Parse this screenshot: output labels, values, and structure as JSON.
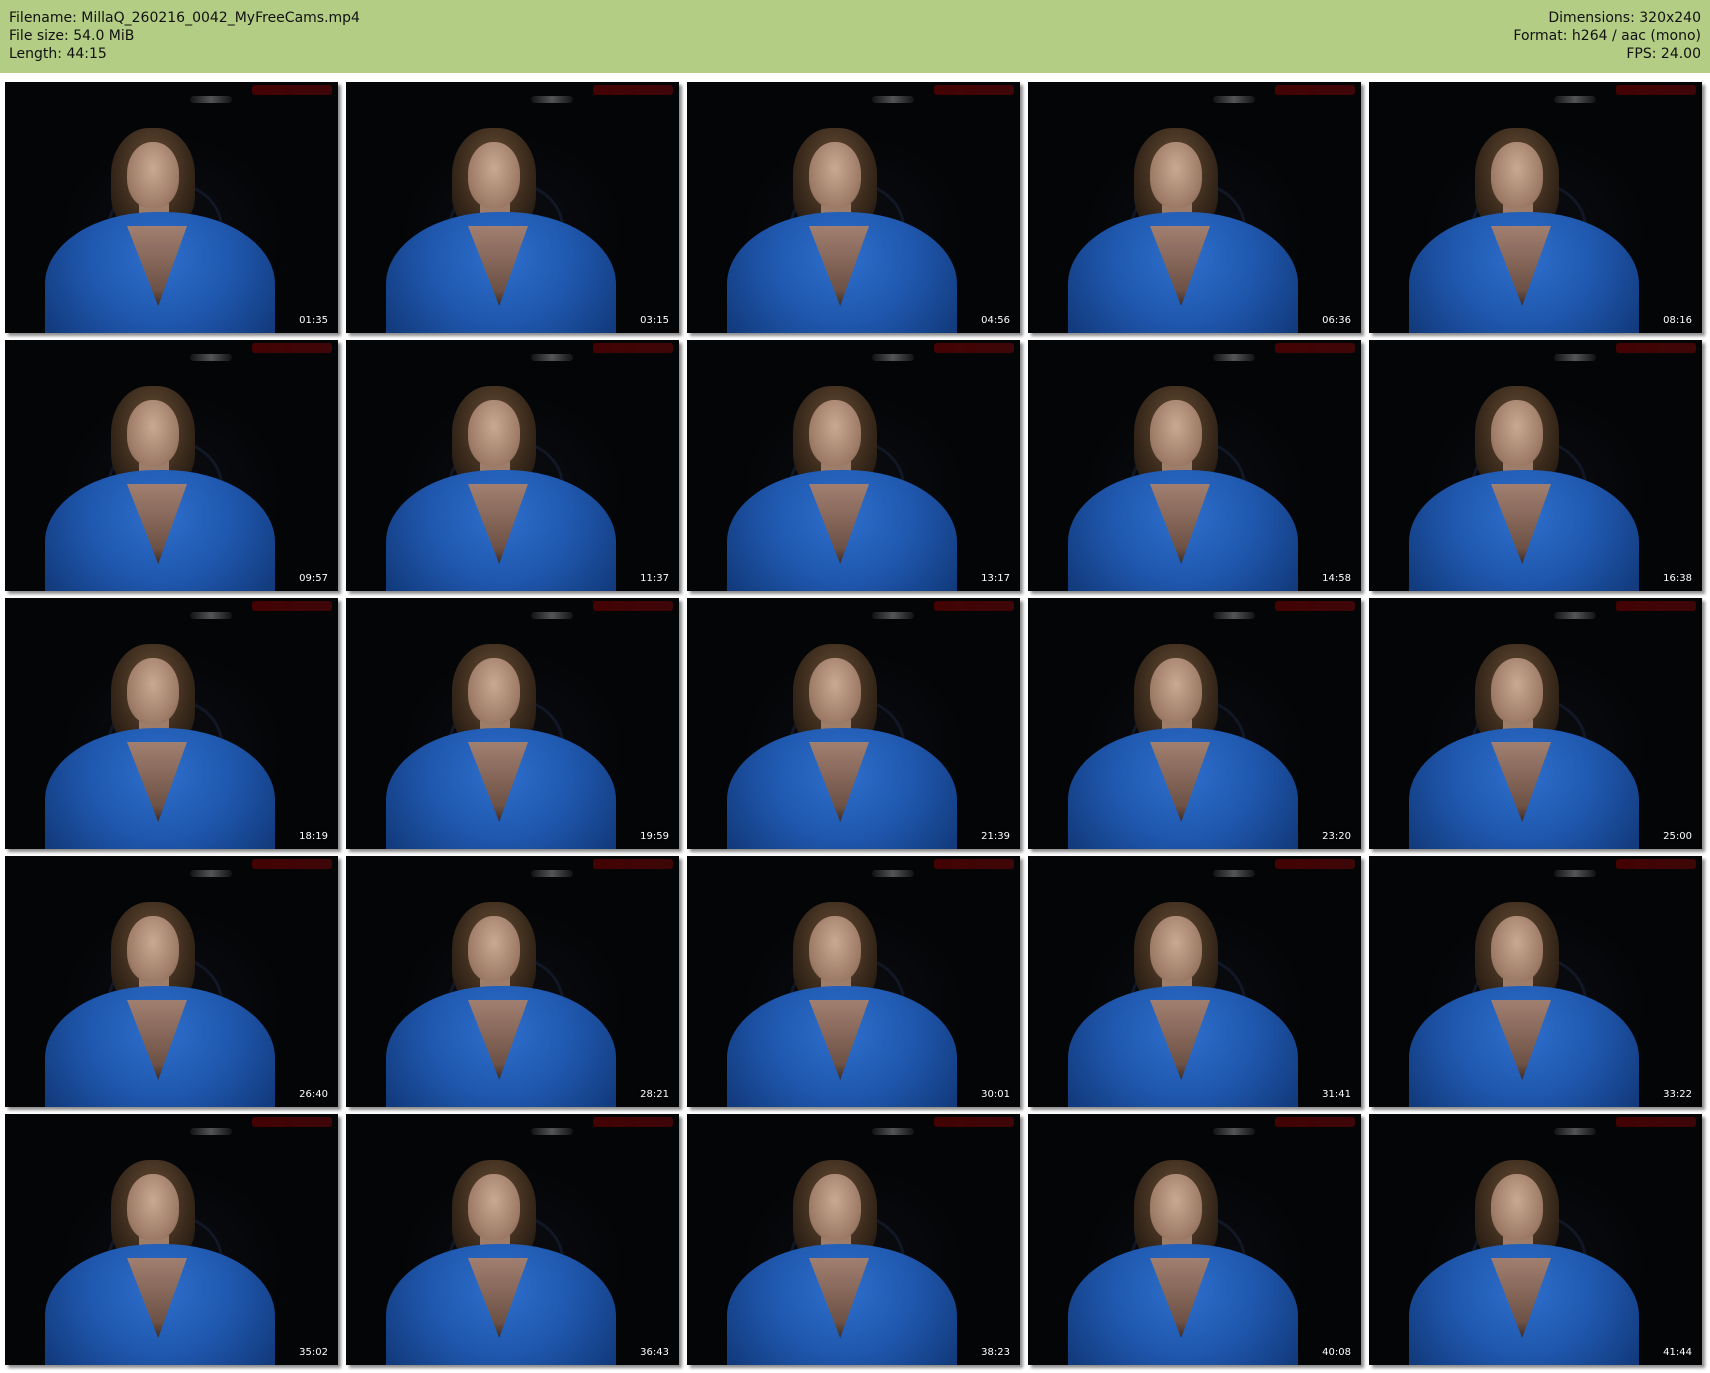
{
  "header": {
    "filename": "Filename: MillaQ_260216_0042_MyFreeCams.mp4",
    "filesize": "File size: 54.0 MiB",
    "length": "Length: 44:15",
    "dimensions": "Dimensions: 320x240",
    "format": "Format: h264 / aac (mono)",
    "fps": "FPS: 24.00"
  },
  "colors": {
    "header_background": "#b3cd84",
    "thumbnail_background": "#050609",
    "top_color": "#1f57ad"
  },
  "thumbnails": [
    {
      "time": "01:35"
    },
    {
      "time": "03:15"
    },
    {
      "time": "04:56"
    },
    {
      "time": "06:36"
    },
    {
      "time": "08:16"
    },
    {
      "time": "09:57"
    },
    {
      "time": "11:37"
    },
    {
      "time": "13:17"
    },
    {
      "time": "14:58"
    },
    {
      "time": "16:38"
    },
    {
      "time": "18:19"
    },
    {
      "time": "19:59"
    },
    {
      "time": "21:39"
    },
    {
      "time": "23:20"
    },
    {
      "time": "25:00"
    },
    {
      "time": "26:40"
    },
    {
      "time": "28:21"
    },
    {
      "time": "30:01"
    },
    {
      "time": "31:41"
    },
    {
      "time": "33:22"
    },
    {
      "time": "35:02"
    },
    {
      "time": "36:43"
    },
    {
      "time": "38:23"
    },
    {
      "time": "40:08"
    },
    {
      "time": "41:44"
    }
  ]
}
